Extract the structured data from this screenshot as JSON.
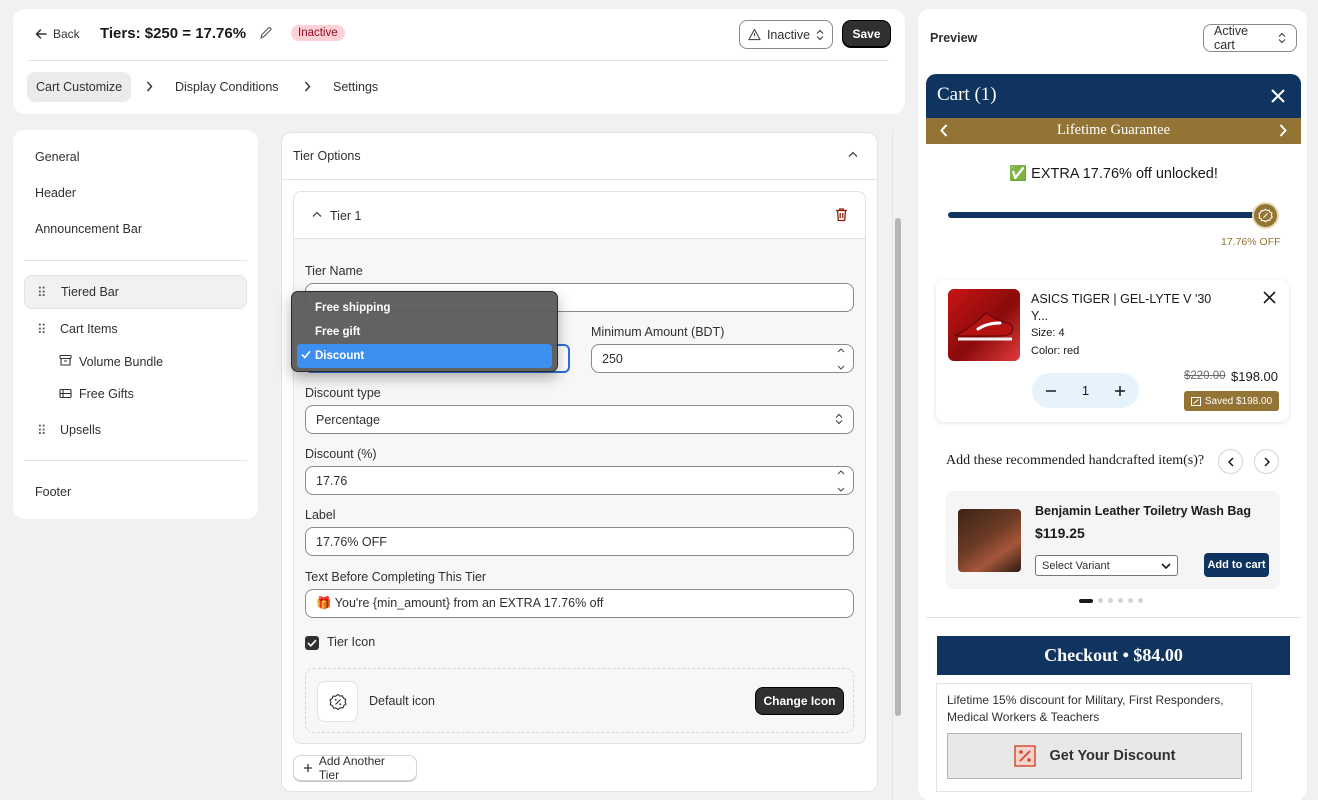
{
  "header": {
    "back_label": "Back",
    "title": "Tiers: $250 = 17.76%",
    "status_badge": "Inactive",
    "status_select_value": "Inactive",
    "save_label": "Save",
    "tabs": [
      {
        "label": "Cart Customize"
      },
      {
        "label": "Display Conditions"
      },
      {
        "label": "Settings"
      }
    ]
  },
  "sidebar": {
    "items": [
      {
        "label": "General"
      },
      {
        "label": "Header"
      },
      {
        "label": "Announcement Bar"
      },
      {
        "label": "Tiered Bar"
      },
      {
        "label": "Cart Items"
      },
      {
        "label": "Volume Bundle"
      },
      {
        "label": "Free Gifts"
      },
      {
        "label": "Upsells"
      },
      {
        "label": "Footer"
      }
    ]
  },
  "tier_options": {
    "section_title": "Tier Options",
    "tier_title": "Tier 1",
    "tier_name_label": "Tier Name",
    "min_amount_label": "Minimum Amount (BDT)",
    "min_amount_value": "250",
    "reward_options": [
      "Free shipping",
      "Free gift",
      "Discount"
    ],
    "reward_selected": "Discount",
    "discount_type_label": "Discount type",
    "discount_type_value": "Percentage",
    "discount_label": "Discount (%)",
    "discount_value": "17.76",
    "label_label": "Label",
    "label_value": "17.76% OFF",
    "text_before_label": "Text Before Completing This Tier",
    "text_before_value": "🎁 You're {min_amount} from an EXTRA 17.76% off",
    "tier_icon_label": "Tier Icon",
    "tier_icon_checked": true,
    "default_icon_label": "Default icon",
    "change_icon_label": "Change Icon",
    "add_tier_label": "Add Another Tier"
  },
  "preview": {
    "title": "Preview",
    "cart_select_value": "Active cart",
    "cart_title": "Cart (1)",
    "announcement": "Lifetime Guarantee",
    "unlock_text": "✅ EXTRA 17.76% off unlocked!",
    "progress_fraction": 1.0,
    "progress_label": "17.76% OFF",
    "item": {
      "name": "ASICS TIGER | GEL-LYTE V '30 Y...",
      "size": "Size: 4",
      "color": "Color: red",
      "qty": "1",
      "price_old": "$220.00",
      "price_new": "$198.00",
      "saved": "Saved $198.00"
    },
    "recommend_title": "Add these recommended handcrafted item(s)?",
    "rec_item": {
      "name": "Benjamin Leather Toiletry Wash Bag",
      "price": "$119.25",
      "variant_placeholder": "Select Variant",
      "add_label": "Add to cart"
    },
    "checkout_label": "Checkout • $84.00",
    "promo_text": "Lifetime 15% discount for Military, First Responders, Medical Workers & Teachers",
    "promo_button": "Get Your Discount"
  },
  "colors": {
    "brand_navy": "#0f3460",
    "brand_gold": "#937434",
    "badge_inactive_bg": "#fed1d7",
    "selected_option": "#3d8fef"
  }
}
